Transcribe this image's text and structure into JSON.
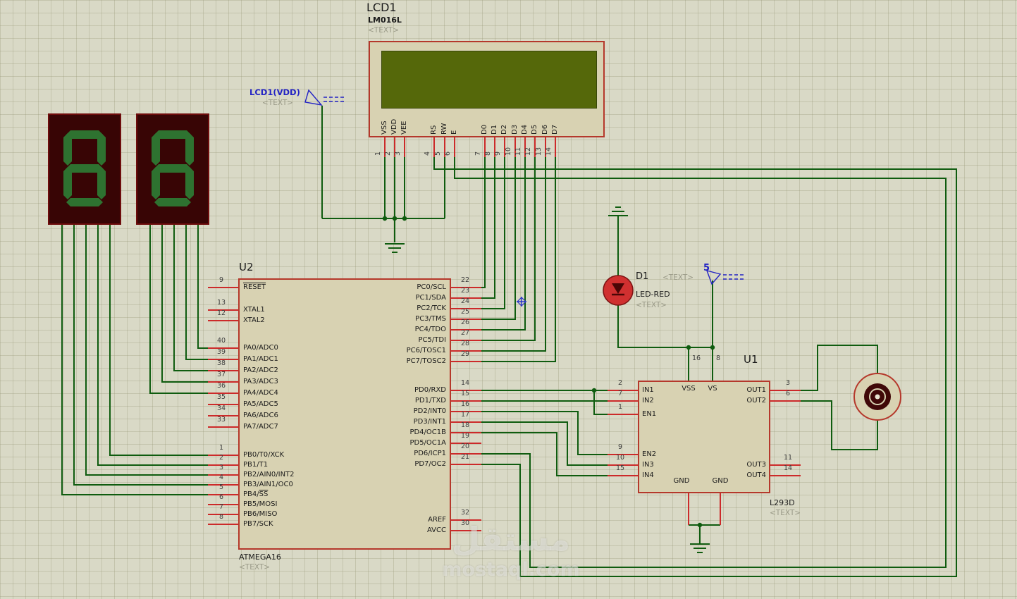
{
  "lcd": {
    "ref": "LCD1",
    "value": "LM016L",
    "placeholder": "<TEXT>",
    "pins": [
      {
        "num": "1",
        "name": "VSS"
      },
      {
        "num": "2",
        "name": "VDD"
      },
      {
        "num": "3",
        "name": "VEE"
      },
      {
        "num": "4",
        "name": "RS"
      },
      {
        "num": "5",
        "name": "RW"
      },
      {
        "num": "6",
        "name": "E"
      },
      {
        "num": "7",
        "name": "D0"
      },
      {
        "num": "8",
        "name": "D1"
      },
      {
        "num": "9",
        "name": "D2"
      },
      {
        "num": "10",
        "name": "D3"
      },
      {
        "num": "11",
        "name": "D4"
      },
      {
        "num": "12",
        "name": "D5"
      },
      {
        "num": "13",
        "name": "D6"
      },
      {
        "num": "14",
        "name": "D7"
      }
    ]
  },
  "vdd_terminal": {
    "label": "LCD1(VDD)",
    "placeholder": "<TEXT>"
  },
  "power_terminal": {
    "label": "5"
  },
  "seven_segment_displays": [
    {
      "digit": "8"
    },
    {
      "digit": "8"
    }
  ],
  "mcu": {
    "ref": "U2",
    "value": "ATMEGA16",
    "placeholder": "<TEXT>",
    "left_groups": [
      [
        {
          "num": "9",
          "ov": "RESET"
        }
      ],
      [
        {
          "num": "13",
          "pre": "XTAL1"
        },
        {
          "num": "12",
          "pre": "XTAL2"
        }
      ],
      [
        {
          "num": "40",
          "pre": "PA0/ADC0"
        },
        {
          "num": "39",
          "pre": "PA1/ADC1"
        },
        {
          "num": "38",
          "pre": "PA2/ADC2"
        },
        {
          "num": "37",
          "pre": "PA3/ADC3"
        },
        {
          "num": "36",
          "pre": "PA4/ADC4"
        },
        {
          "num": "35",
          "pre": "PA5/ADC5"
        },
        {
          "num": "34",
          "pre": "PA6/ADC6"
        },
        {
          "num": "33",
          "pre": "PA7/ADC7"
        }
      ],
      [
        {
          "num": "1",
          "pre": "PB0/T0/XCK"
        },
        {
          "num": "2",
          "pre": "PB1/T1"
        },
        {
          "num": "3",
          "pre": "PB2/AIN0/INT2"
        },
        {
          "num": "4",
          "pre": "PB3/AIN1/OC0"
        },
        {
          "num": "5",
          "pre": "PB4/",
          "ov": "SS"
        },
        {
          "num": "6",
          "pre": "PB5/MOSI"
        },
        {
          "num": "7",
          "pre": "PB6/MISO"
        },
        {
          "num": "8",
          "pre": "PB7/SCK"
        }
      ]
    ],
    "right_groups": [
      [
        {
          "num": "22",
          "pre": "PC0/SCL"
        },
        {
          "num": "23",
          "pre": "PC1/SDA"
        },
        {
          "num": "24",
          "pre": "PC2/TCK"
        },
        {
          "num": "25",
          "pre": "PC3/TMS"
        },
        {
          "num": "26",
          "pre": "PC4/TDO"
        },
        {
          "num": "27",
          "pre": "PC5/TDI"
        },
        {
          "num": "28",
          "pre": "PC6/TOSC1"
        },
        {
          "num": "29",
          "pre": "PC7/TOSC2"
        }
      ],
      [
        {
          "num": "14",
          "pre": "PD0/RXD"
        },
        {
          "num": "15",
          "pre": "PD1/TXD"
        },
        {
          "num": "16",
          "pre": "PD2/INT0"
        },
        {
          "num": "17",
          "pre": "PD3/INT1"
        },
        {
          "num": "18",
          "pre": "PD4/OC1B"
        },
        {
          "num": "19",
          "pre": "PD5/OC1A"
        },
        {
          "num": "20",
          "pre": "PD6/ICP1"
        },
        {
          "num": "21",
          "pre": "PD7/OC2"
        }
      ],
      [
        {
          "num": "32",
          "pre": "AREF"
        },
        {
          "num": "30",
          "pre": "AVCC"
        }
      ]
    ]
  },
  "led": {
    "ref": "D1",
    "value": "LED-RED",
    "placeholder1": "<TEXT>",
    "placeholder2": "<TEXT>"
  },
  "driver": {
    "ref": "U1",
    "value": "L293D",
    "placeholder": "<TEXT>",
    "top_pins": [
      {
        "num": "16",
        "pre": "VSS"
      },
      {
        "num": "8",
        "pre": "VS"
      }
    ],
    "left_pins": [
      {
        "num": "2",
        "pre": "IN1"
      },
      {
        "num": "7",
        "pre": "IN2"
      },
      {
        "num": "1",
        "pre": "EN1"
      },
      {
        "num": "9",
        "pre": "EN2"
      },
      {
        "num": "10",
        "pre": "IN3"
      },
      {
        "num": "15",
        "pre": "IN4"
      }
    ],
    "right_pins": [
      {
        "num": "3",
        "pre": "OUT1"
      },
      {
        "num": "6",
        "pre": "OUT2"
      },
      {
        "num": "11",
        "pre": "OUT3"
      },
      {
        "num": "14",
        "pre": "OUT4"
      }
    ],
    "gnd_labels": [
      "GND",
      "GND"
    ]
  },
  "watermark": {
    "line1": "مستقل",
    "line2": "mostaql.com"
  },
  "colors": {
    "wire": "#0f5c0f",
    "pin_stub": "#cc2a2a",
    "component_outline": "#b5382b",
    "component_fill": "#d8d2b2",
    "lcd_screen": "#55680a",
    "display_body": "#380505",
    "segment": "#2e7230",
    "led_body": "#d03030",
    "terminal_blue": "#2323c4"
  }
}
